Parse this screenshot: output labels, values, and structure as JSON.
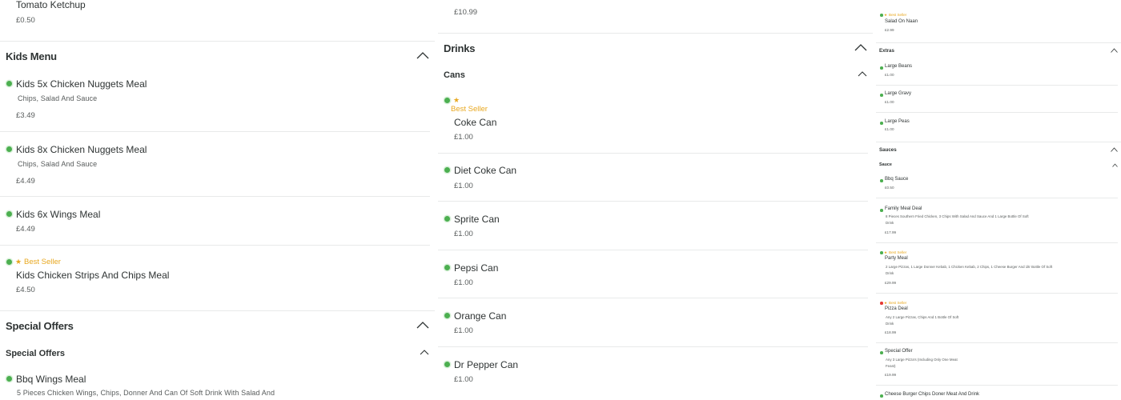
{
  "col1": {
    "top_item": {
      "name": "Tomato Ketchup",
      "price": "£0.50"
    },
    "kids_menu": {
      "title": "Kids Menu",
      "items": [
        {
          "name": "Kids 5x Chicken Nuggets Meal",
          "desc": "Chips, Salad And Sauce",
          "price": "£3.49"
        },
        {
          "name": "Kids 8x Chicken Nuggets Meal",
          "desc": "Chips, Salad And Sauce",
          "price": "£4.49"
        },
        {
          "name": "Kids 6x Wings Meal",
          "price": "£4.49"
        },
        {
          "badge": "Best Seller",
          "name": "Kids Chicken Strips And Chips Meal",
          "price": "£4.50"
        }
      ]
    },
    "special_offers": {
      "title": "Special Offers",
      "subtitle": "Special Offers",
      "items": [
        {
          "name": "Bbq Wings Meal",
          "desc": "5 Pieces Chicken Wings, Chips, Donner And Can Of Soft Drink With Salad And"
        }
      ]
    }
  },
  "col2": {
    "top_item": {
      "price": "£10.99"
    },
    "drinks": {
      "title": "Drinks",
      "subtitle": "Cans",
      "items": [
        {
          "badge": "Best Seller",
          "name": "Coke Can",
          "price": "£1.00"
        },
        {
          "name": "Diet Coke Can",
          "price": "£1.00"
        },
        {
          "name": "Sprite Can",
          "price": "£1.00"
        },
        {
          "name": "Pepsi Can",
          "price": "£1.00"
        },
        {
          "name": "Orange Can",
          "price": "£1.00"
        },
        {
          "name": "Dr Pepper Can",
          "price": "£1.00"
        }
      ]
    }
  },
  "col3": {
    "top_item": {
      "badge": "Best Seller",
      "name": "Salad On Naan",
      "price": "£2.99"
    },
    "extras": {
      "title": "Extras",
      "items": [
        {
          "name": "Large Beans",
          "price": "£1.00"
        },
        {
          "name": "Large Gravy",
          "price": "£1.00"
        },
        {
          "name": "Large Peas",
          "price": "£1.00"
        }
      ]
    },
    "sauces": {
      "title": "Sauces",
      "subtitle": "Sauce",
      "items": [
        {
          "name": "Bbq Sauce",
          "price": "£0.50"
        }
      ]
    },
    "deals": [
      {
        "name": "Family Meal Deal",
        "desc1": "8 Pieces Southern Fried Chicken, 3 Chips With Salad And Sauce And 1 Large Bottle Of Soft",
        "desc2": "Drink",
        "price": "£17.99"
      },
      {
        "badge": "Best Seller",
        "name": "Party Meal",
        "desc1": "2 Large Pizzas, 1 Large Donner Kebab, 1 Chicken Kebab, 2 Chips, 1 Cheese Burger And 1ltr Bottle Of Soft",
        "desc2": "Drink",
        "price": "£29.99"
      },
      {
        "badge": "Best Seller",
        "name": "Pizza Deal",
        "desc1": "Any 2 Large Pizzas, Chips And 1 Bottle Of Soft",
        "desc2": "Drink",
        "price": "£18.99"
      },
      {
        "name": "Special Offer",
        "desc1": "Any 3 Large Pizza's (Including Only One Meat",
        "desc2": "Feast)",
        "price": "£19.99"
      },
      {
        "name": "Cheese Burger Chips Doner Meat And Drink"
      }
    ]
  },
  "colors": {
    "accent_green": "#4caf50",
    "best_seller": "#e8a820",
    "unavailable_red": "#e53935",
    "text": "#2e3333",
    "muted": "#585c5c",
    "divider": "#e8eaea"
  },
  "icons": [
    "chevron-up-icon",
    "star-icon",
    "availability-dot-icon"
  ]
}
